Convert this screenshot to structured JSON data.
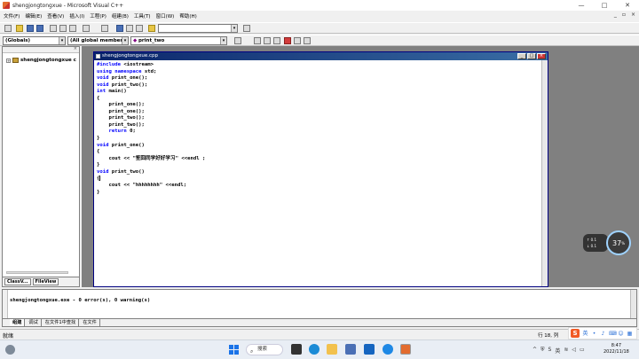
{
  "window": {
    "title": "shengjongtongxue - Microsoft Visual C++",
    "controls": [
      "—",
      "□",
      "✕"
    ]
  },
  "menu": [
    "文件(F)",
    "编辑(E)",
    "查看(V)",
    "插入(I)",
    "工程(P)",
    "组建(B)",
    "工具(T)",
    "窗口(W)",
    "帮助(H)"
  ],
  "toolbar": {
    "class_combo": "(Globals)",
    "members_combo": "(All global member",
    "function_combo": "print_two"
  },
  "workspace": {
    "project_label": "shengjongtongxue c",
    "tabs": [
      "ClassV...",
      "FileView"
    ]
  },
  "editor": {
    "title": "shengjongtongxue.cpp",
    "code": [
      "#include <iostream>",
      "using namespace std;",
      "void print_one();",
      "void print_two();",
      "int main()",
      "{",
      "    print_one();",
      "    print_one();",
      "    print_two();",
      "    print_two();",
      "    return 0;",
      "}",
      "void print_one()",
      "{",
      "    cout << \"笙囧同学好好学习\" <<endl ;",
      "}",
      "void print_two()",
      "{",
      "    cout << \"hhhhhhhh\" <<endl;",
      "}"
    ]
  },
  "output": {
    "text": "shengjongtongxue.exe - 0 error(s), 0 warning(s)",
    "tabs": [
      "组建",
      "调试",
      "在文件1中查找",
      "在文件"
    ]
  },
  "status": {
    "text": "就绪",
    "position": "行 18, 列"
  },
  "widgets": {
    "net_up": "0.1",
    "net_down": "0.1",
    "cpu": "37"
  },
  "taskbar": {
    "search": "搜索",
    "time": "8:47",
    "date": "2022/11/18"
  }
}
